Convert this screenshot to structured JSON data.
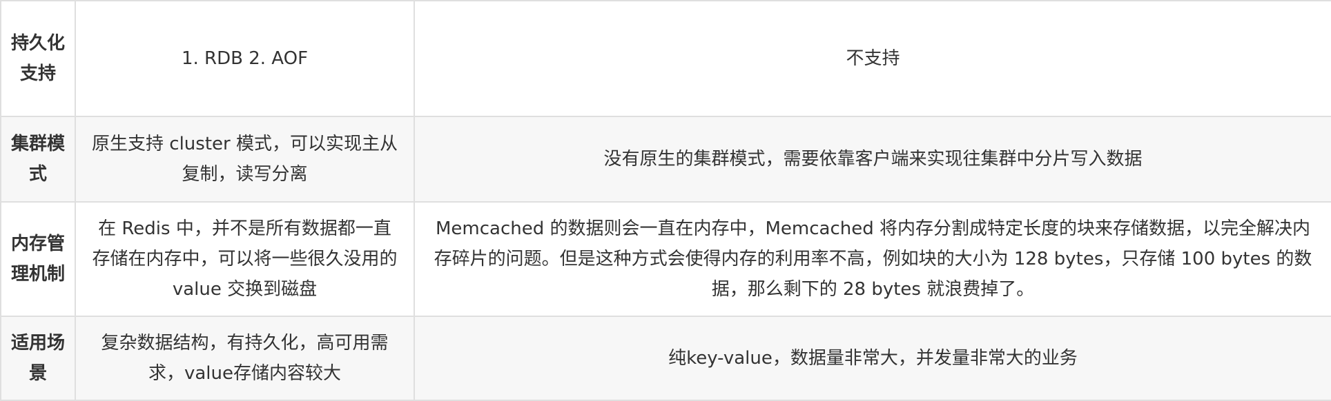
{
  "rows": [
    {
      "key": "持久化支持",
      "redis": "1. RDB 2. AOF",
      "memcached": "不支持"
    },
    {
      "key": "集群模式",
      "redis": "原生支持 cluster 模式，可以实现主从复制，读写分离",
      "memcached": "没有原生的集群模式，需要依靠客户端来实现往集群中分片写入数据"
    },
    {
      "key": "内存管理机制",
      "redis": "在 Redis 中，并不是所有数据都一直存储在内存中，可以将一些很久没用的 value 交换到磁盘",
      "memcached": "Memcached 的数据则会一直在内存中，Memcached 将内存分割成特定长度的块来存储数据，以完全解决内存碎片的问题。但是这种方式会使得内存的利用率不高，例如块的大小为 128 bytes，只存储 100 bytes 的数据，那么剩下的 28 bytes 就浪费掉了。"
    },
    {
      "key": "适用场景",
      "redis": "复杂数据结构，有持久化，高可用需求，value存储内容较大",
      "memcached": "纯key-value，数据量非常大，并发量非常大的业务"
    }
  ]
}
